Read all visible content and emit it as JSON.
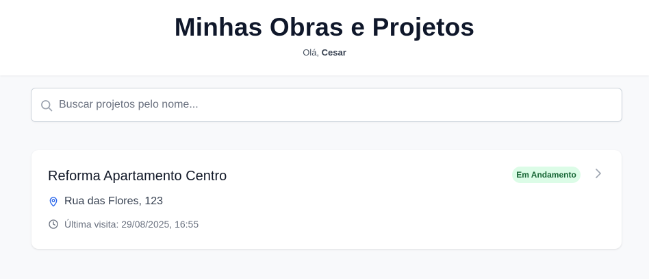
{
  "header": {
    "title": "Minhas Obras e Projetos",
    "greeting_prefix": "Olá,",
    "user_name": "Cesar"
  },
  "search": {
    "placeholder": "Buscar projetos pelo nome...",
    "value": "",
    "icon": "search-icon"
  },
  "projects": [
    {
      "name": "Reforma Apartamento Centro",
      "status": "Em Andamento",
      "address": "Rua das Flores, 123",
      "last_visit": "Última visita: 29/08/2025, 16:55",
      "icons": {
        "address": "map-pin-icon",
        "visit": "clock-icon",
        "open": "chevron-right-icon"
      }
    }
  ],
  "colors": {
    "background": "#f8f9fb",
    "status_bg": "#dcfce7",
    "status_text": "#166534",
    "pin": "#2563eb"
  }
}
